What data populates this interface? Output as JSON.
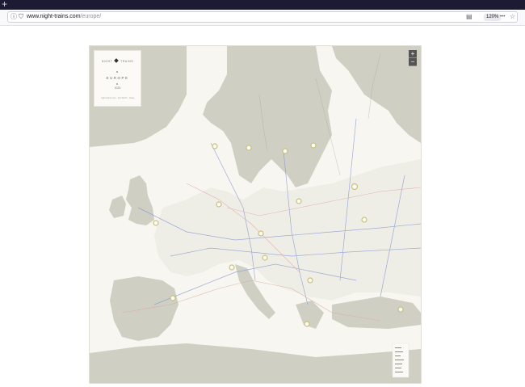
{
  "browser": {
    "new_tab_symbol": "+",
    "url_host_prefix": "www.",
    "url_host": "night-trains.com",
    "url_path": "/europe/",
    "zoom_level": "120%",
    "page_actions_symbol": "•••",
    "bookmark_symbol": "☆",
    "reader_symbol": "▤",
    "info_symbol": "ⓘ",
    "shield_symbol": "⛉"
  },
  "map": {
    "brand_left": "NIGHT",
    "brand_right": "TRAINS",
    "title": "EUROPE",
    "year": "2023",
    "credit": "night-trains.com · Jon Worth · Clara",
    "zoom_in_label": "+",
    "zoom_out_label": "−",
    "colors": {
      "sea": "#f7f6f0",
      "land": "#cfcfc4",
      "line": "#8a9bd0"
    }
  }
}
